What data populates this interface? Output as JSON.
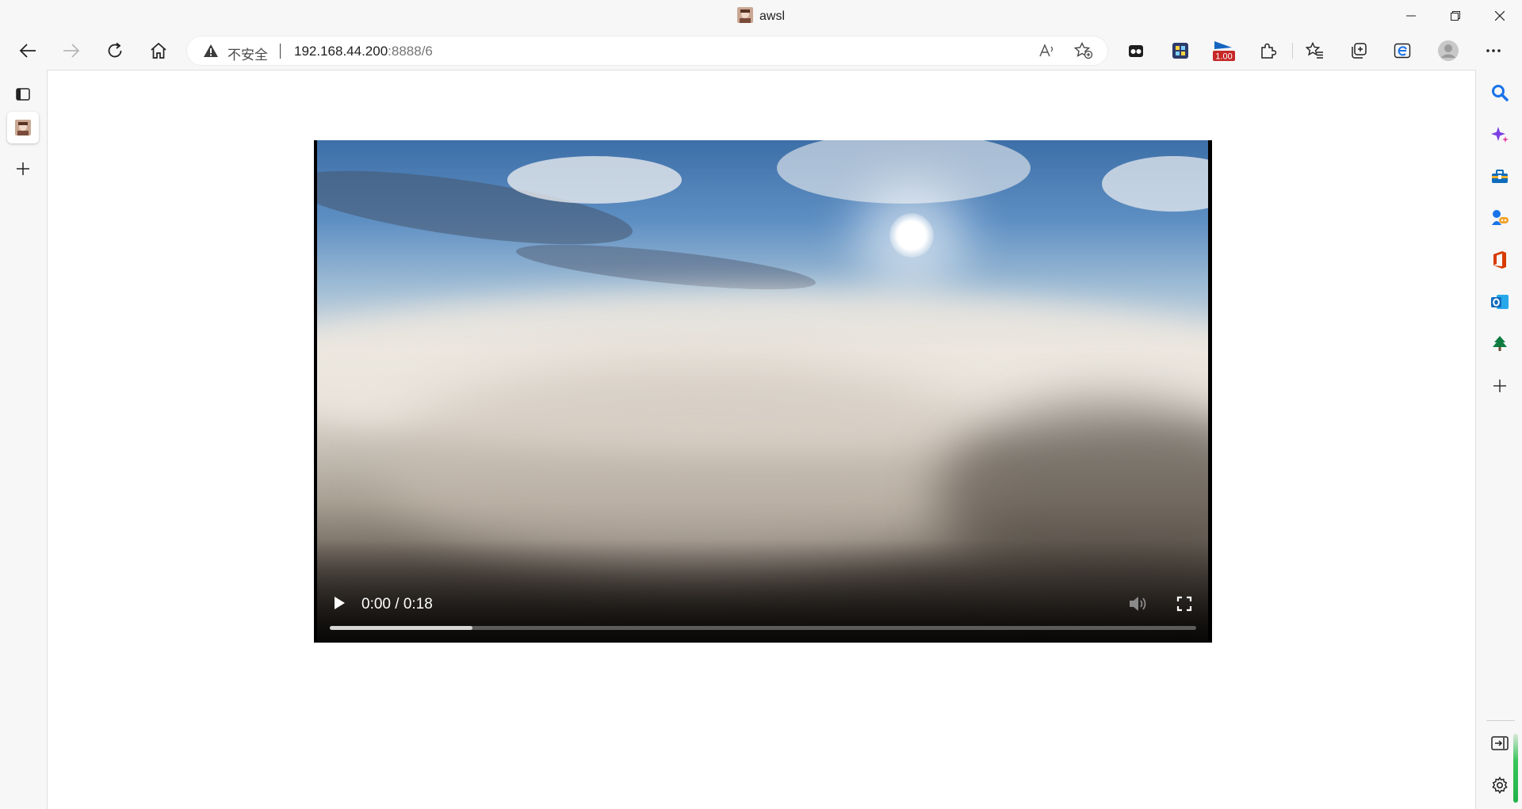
{
  "window": {
    "title": "awsl",
    "controls": [
      "minimize-icon",
      "restore-icon",
      "close-icon"
    ]
  },
  "toolbar": {
    "nav": [
      "back-icon",
      "forward-icon",
      "refresh-icon",
      "home-icon"
    ],
    "address": {
      "security_label": "不安全",
      "url_host": "192.168.44.200",
      "url_rest": ":8888/6"
    },
    "address_icons": [
      "read-aloud-icon",
      "add-favorite-icon"
    ],
    "extensions": {
      "badge": "1.00",
      "icons": [
        "extension-dark-icon",
        "extension-qr-icon",
        "extension-speed-icon",
        "extensions-puzzle-icon",
        "favorites-icon",
        "collections-icon",
        "edge-bar-icon",
        "profile-avatar-icon",
        "more-menu-icon"
      ]
    }
  },
  "tabs": {
    "items": [
      "tab-actions-icon",
      "active-tab-favicon",
      "new-tab-icon"
    ]
  },
  "video": {
    "current_time": "0:00",
    "separator": "/",
    "duration": "0:18",
    "buffered_fraction": 0.165,
    "controls": [
      "play-icon",
      "mute-icon",
      "fullscreen-icon",
      "more-options-icon"
    ]
  },
  "sidebar": {
    "icons": [
      "search-icon",
      "copilot-icon",
      "tools-icon",
      "games-icon",
      "office-icon",
      "outlook-icon",
      "tree-icon",
      "add-icon"
    ],
    "bottom_icons": [
      "hide-sidebar-icon",
      "settings-icon"
    ],
    "colors": {
      "search": "#1a73e8",
      "copilot": "#7b3fe4",
      "office": "#d83b01",
      "outlook": "#0f6cbd",
      "tree": "#107c41"
    }
  }
}
